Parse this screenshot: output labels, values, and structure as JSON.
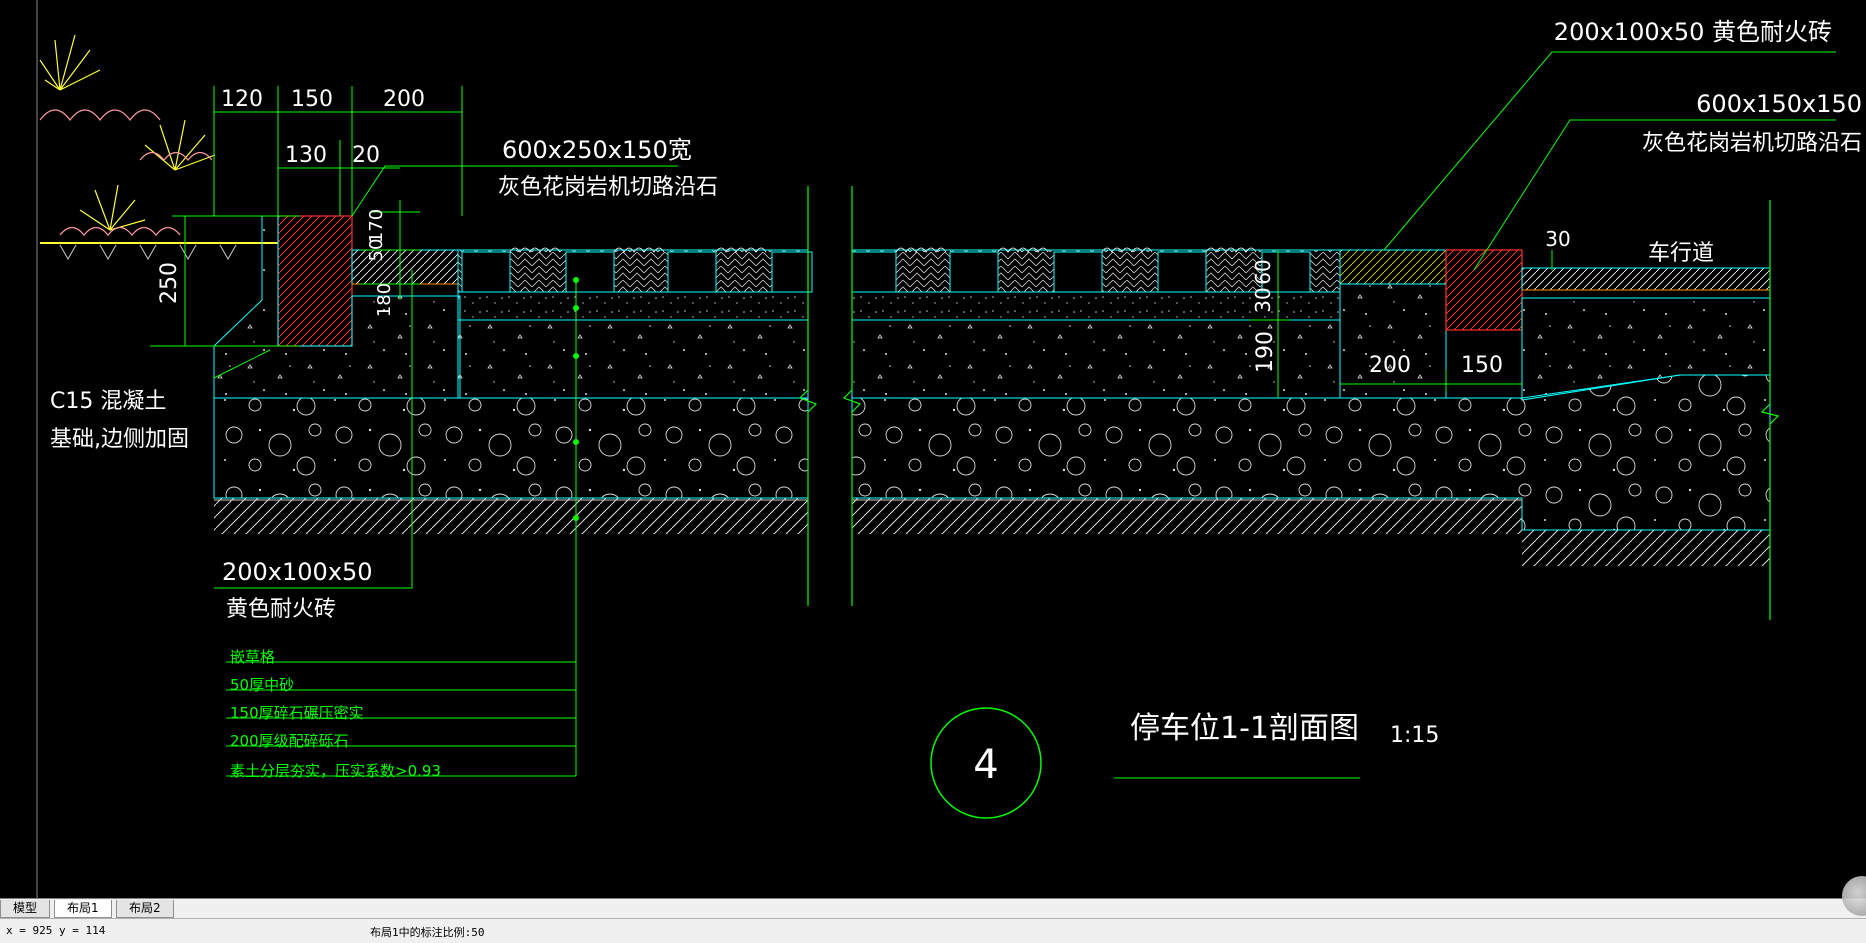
{
  "drawing": {
    "title": "停车位1-1剖面图",
    "scale": "1:15",
    "section_number": "4",
    "callouts": {
      "top_brick": "200x100x50 黄色耐火砖",
      "right_curb_size": "600x150x150",
      "right_curb_desc": "灰色花岗岩机切路沿石",
      "left_curb_size": "600x250x150宽",
      "left_curb_desc": "灰色花岗岩机切路沿石",
      "concrete_line1": "C15 混凝土",
      "concrete_line2": "基础,边侧加固",
      "bottom_brick_size": "200x100x50",
      "bottom_brick_desc": "黄色耐火砖",
      "roadway": "车行道"
    },
    "dims": {
      "d120": "120",
      "d150": "150",
      "d200": "200",
      "d130": "130",
      "d20": "20",
      "d250": "250",
      "d50": "50",
      "d170": "170",
      "d180": "180",
      "d30": "30",
      "d60": "60",
      "d190": "190",
      "d200b": "200",
      "d150b": "150",
      "d30b": "30"
    },
    "layers": [
      "嵌草格",
      "50厚中砂",
      "150厚碎石碾压密实",
      "200厚级配碎砾石",
      "素土分层夯实，压实系数>0.93"
    ]
  },
  "tabs": {
    "model": "模型",
    "layout1": "布局1",
    "layout2": "布局2"
  },
  "status": {
    "coords": "x = 925 y = 114",
    "scale_text": "布局1中的标注比例:50"
  }
}
